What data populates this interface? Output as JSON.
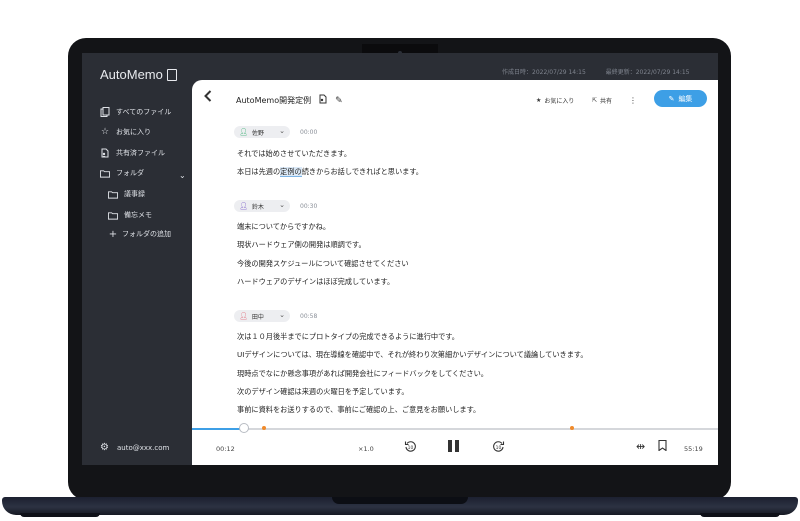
{
  "app": {
    "logo": "AutoMemo",
    "created": "作成日時：2022/07/29 14:15",
    "updated": "最終更新：2022/07/29 14:15"
  },
  "sidebar": {
    "items": [
      {
        "label": "すべてのファイル",
        "icon": "file-stack-icon"
      },
      {
        "label": "お気に入り",
        "icon": "star-icon"
      },
      {
        "label": "共有済ファイル",
        "icon": "shared-file-icon"
      },
      {
        "label": "フォルダ",
        "icon": "folder-icon"
      },
      {
        "label": "議事録",
        "icon": "folder-icon"
      },
      {
        "label": "備忘メモ",
        "icon": "folder-icon"
      },
      {
        "label": "フォルダの追加",
        "icon": "plus-icon"
      }
    ],
    "user": "auto@xxx.com"
  },
  "header": {
    "title": "AutoMemo開発定例",
    "favorite_label": "お気に入り",
    "share_label": "共有",
    "edit_label": "編集"
  },
  "transcript": [
    {
      "speaker": "佐野",
      "time": "00:00",
      "color": "#3bb273",
      "lines": [
        "それでは始めさせていただきます。",
        "本日は先週の定例の続きからお話しできればと思います。"
      ]
    },
    {
      "speaker": "鈴木",
      "time": "00:30",
      "color": "#7a5cc8",
      "lines": [
        "端末についてからですかね。",
        "現状ハードウェア側の開発は順調です。",
        "今後の開発スケジュールについて確認させてください",
        "ハードウェアのデザインはほぼ完成しています。"
      ]
    },
    {
      "speaker": "田中",
      "time": "00:58",
      "color": "#e06a7a",
      "lines": [
        "次は１０月後半までにプロトタイプの完成できるように進行中です。",
        "UIデザインについては、現在導線を確認中で、それが終わり次第細かいデザインについて議論していきます。",
        "現時点でなにか懸念事項があれば開発会社にフィードバックをしてください。",
        "次のデザイン確認は来週の火曜日を予定しています。",
        "事前に資料をお送りするので、事前にご確認の上、ご意見をお願いします。"
      ]
    }
  ],
  "highlight": {
    "before": "本日は先週の",
    "word": "定例の",
    "after": "続きからお話しできればと思います。"
  },
  "player": {
    "current": "00:12",
    "speed": "×1.0",
    "duration": "55:19",
    "progress_fraction": 0.1
  },
  "colors": {
    "accent": "#3d9fe6",
    "marker": "#f08a2a",
    "sidebar": "#2b2e35"
  }
}
